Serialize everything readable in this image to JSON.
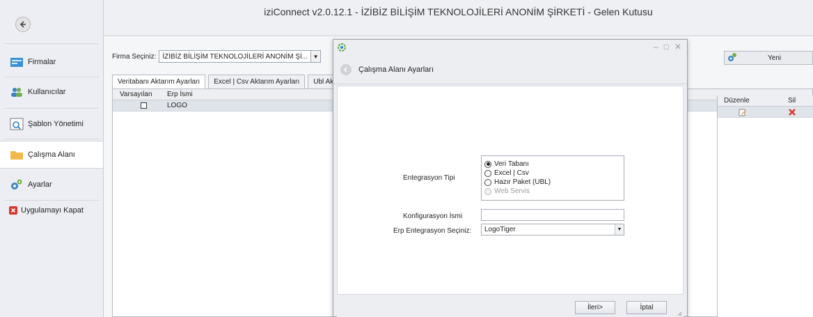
{
  "window": {
    "title": "iziConnect v2.0.12.1  - İZİBİZ BİLİŞİM TEKNOLOJİLERİ ANONİM ŞİRKETİ - Gelen Kutusu"
  },
  "sidebar": {
    "items": [
      {
        "label": "Firmalar",
        "icon": "company-icon"
      },
      {
        "label": "Kullanıcılar",
        "icon": "users-icon"
      },
      {
        "label": "Şablon Yönetimi",
        "icon": "template-icon"
      },
      {
        "label": "Çalışma Alanı",
        "icon": "folder-icon",
        "active": true
      },
      {
        "label": "Ayarlar",
        "icon": "gears-icon"
      },
      {
        "label": "Uygulamayı Kapat",
        "icon": "close-app-icon"
      }
    ]
  },
  "main": {
    "firma_label": "Firma Seçiniz:",
    "firma_value": "İZİBİZ BİLİŞİM TEKNOLOJİLERİ ANONİM Şİ...",
    "yeni_label": "Yeni",
    "tabs": [
      {
        "label": "Veritabanı Aktarım Ayarları",
        "active": true
      },
      {
        "label": "Excel | Csv Aktarım Ayarları"
      },
      {
        "label": "Ubl Ak"
      }
    ],
    "grid": {
      "columns": [
        "Varsayılan",
        "Erp İsmi",
        "Düzenle",
        "Sil"
      ],
      "rows": [
        {
          "default": false,
          "erp_name": "LOGO"
        }
      ]
    }
  },
  "dialog": {
    "header": "Çalışma Alanı Ayarları",
    "integration_type_label": "Entegrasyon Tipi",
    "options": [
      {
        "label": "Veri Tabanı",
        "selected": true,
        "enabled": true
      },
      {
        "label": "Excel | Csv",
        "selected": false,
        "enabled": true
      },
      {
        "label": "Hazır Paket (UBL)",
        "selected": false,
        "enabled": true
      },
      {
        "label": "Web Servis",
        "selected": false,
        "enabled": false
      }
    ],
    "config_name_label": "Konfigurasyon İsmi",
    "config_name_value": "",
    "erp_label": "Erp Entegrasyon Seçiniz:",
    "erp_value": "LogoTiger",
    "next_label": "İleri>",
    "cancel_label": "İptal"
  },
  "colors": {
    "accent_folder": "#f2b84b",
    "delete_red": "#d9342b"
  }
}
